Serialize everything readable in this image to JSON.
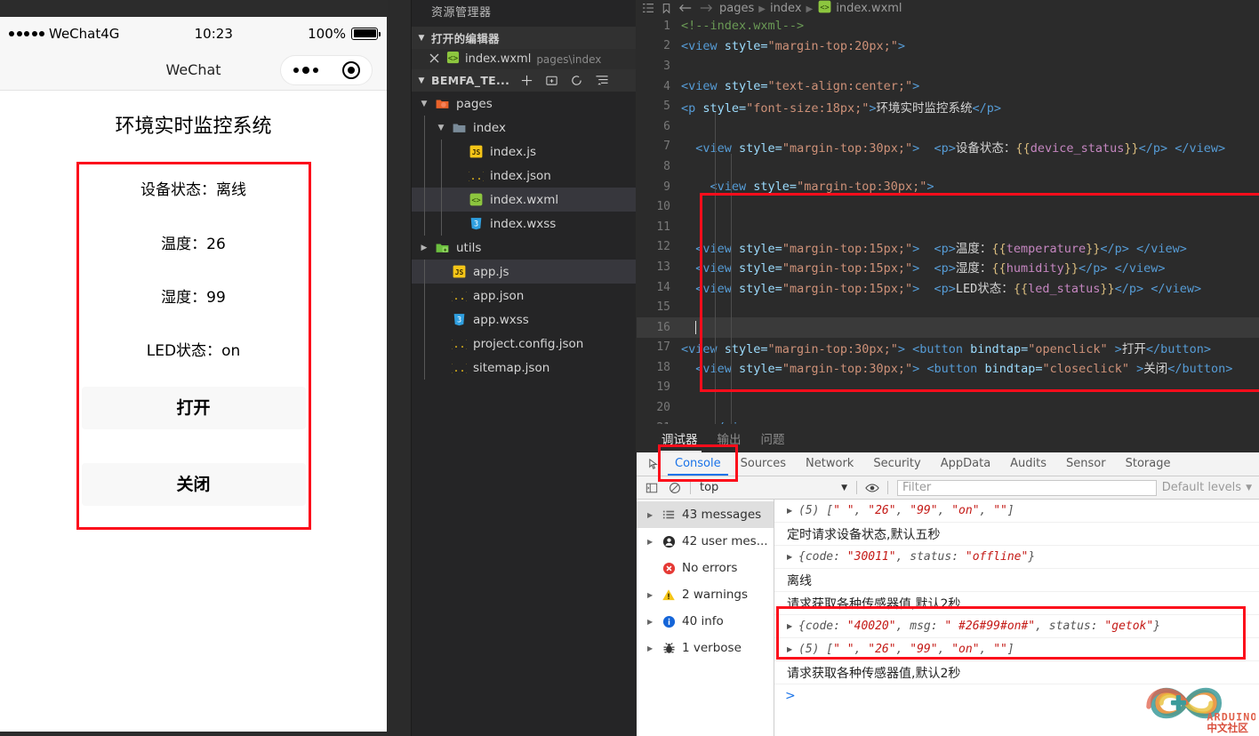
{
  "simulator": {
    "status_bar": {
      "carrier": "WeChat4G",
      "time": "10:23",
      "battery": "100%"
    },
    "nav": {
      "title": "WeChat"
    },
    "app": {
      "title": "环境实时监控系统",
      "device_status_label": "设备状态：",
      "device_status_value": "离线",
      "temperature_label": "温度：",
      "temperature_value": "26",
      "humidity_label": "湿度：",
      "humidity_value": "99",
      "led_label": "LED状态：",
      "led_value": "on",
      "open_button": "打开",
      "close_button": "关闭"
    }
  },
  "explorer": {
    "title": "资源管理器",
    "open_editors": {
      "label": "打开的编辑器",
      "file": "index.wxml",
      "path": "pages\\index"
    },
    "project": {
      "label": "BEMFA_TE..."
    },
    "tree": [
      {
        "name": "pages",
        "icon": "folder-open-orange",
        "depth": 1,
        "twisty": "▼",
        "selected": false
      },
      {
        "name": "index",
        "icon": "folder-open-gray",
        "depth": 2,
        "twisty": "▼",
        "selected": false
      },
      {
        "name": "index.js",
        "icon": "js",
        "depth": 3,
        "twisty": "",
        "selected": false
      },
      {
        "name": "index.json",
        "icon": "json",
        "depth": 3,
        "twisty": "",
        "selected": false
      },
      {
        "name": "index.wxml",
        "icon": "wxml",
        "depth": 3,
        "twisty": "",
        "selected": true
      },
      {
        "name": "index.wxss",
        "icon": "css",
        "depth": 3,
        "twisty": "",
        "selected": false
      },
      {
        "name": "utils",
        "icon": "folder-green",
        "depth": 1,
        "twisty": "▶",
        "selected": false
      },
      {
        "name": "app.js",
        "icon": "js",
        "depth": 2,
        "twisty": "",
        "selected": true
      },
      {
        "name": "app.json",
        "icon": "json",
        "depth": 2,
        "twisty": "",
        "selected": false
      },
      {
        "name": "app.wxss",
        "icon": "css",
        "depth": 2,
        "twisty": "",
        "selected": false
      },
      {
        "name": "project.config.json",
        "icon": "json",
        "depth": 2,
        "twisty": "",
        "selected": false
      },
      {
        "name": "sitemap.json",
        "icon": "json",
        "depth": 2,
        "twisty": "",
        "selected": false
      }
    ]
  },
  "editor": {
    "breadcrumb": [
      "pages",
      "index",
      "index.wxml"
    ],
    "lines": [
      {
        "n": 1,
        "tokens": [
          {
            "t": "cmt",
            "v": "<!--index.wxml-->"
          }
        ],
        "indent": 0
      },
      {
        "n": 2,
        "tokens": [
          {
            "t": "tag",
            "v": "<view"
          },
          {
            "t": "attr",
            "v": " style="
          },
          {
            "t": "str",
            "v": "\"margin-top:20px;\""
          },
          {
            "t": "tag",
            "v": ">"
          }
        ],
        "indent": 0
      },
      {
        "n": 3,
        "tokens": [],
        "indent": 0
      },
      {
        "n": 4,
        "tokens": [
          {
            "t": "tag",
            "v": "<view"
          },
          {
            "t": "attr",
            "v": " style="
          },
          {
            "t": "str",
            "v": "\"text-align:center;\""
          },
          {
            "t": "tag",
            "v": ">"
          }
        ],
        "indent": 0
      },
      {
        "n": 5,
        "tokens": [
          {
            "t": "tag",
            "v": "<p"
          },
          {
            "t": "attr",
            "v": " style="
          },
          {
            "t": "str",
            "v": "\"font-size:18px;\""
          },
          {
            "t": "tag",
            "v": ">"
          },
          {
            "t": "txt",
            "v": "环境实时监控系统"
          },
          {
            "t": "tag",
            "v": "</p>"
          }
        ],
        "indent": 0
      },
      {
        "n": 6,
        "tokens": [],
        "indent": 0
      },
      {
        "n": 7,
        "tokens": [
          {
            "t": "tag",
            "v": "<view"
          },
          {
            "t": "attr",
            "v": " style="
          },
          {
            "t": "str",
            "v": "\"margin-top:30px;\""
          },
          {
            "t": "tag",
            "v": ">"
          },
          {
            "t": "txt",
            "v": "  "
          },
          {
            "t": "tag",
            "v": "<p>"
          },
          {
            "t": "txt",
            "v": "设备状态："
          },
          {
            "t": "brk",
            "v": "{{"
          },
          {
            "t": "pnk",
            "v": "device_status"
          },
          {
            "t": "brk",
            "v": "}}"
          },
          {
            "t": "tag",
            "v": "</p>"
          },
          {
            "t": "txt",
            "v": " "
          },
          {
            "t": "tag",
            "v": "</view>"
          }
        ],
        "indent": 1
      },
      {
        "n": 8,
        "tokens": [],
        "indent": 1
      },
      {
        "n": 9,
        "tokens": [
          {
            "t": "tag",
            "v": "<view"
          },
          {
            "t": "attr",
            "v": " style="
          },
          {
            "t": "str",
            "v": "\"margin-top:30px;\""
          },
          {
            "t": "tag",
            "v": ">"
          }
        ],
        "indent": 2
      },
      {
        "n": 10,
        "tokens": [],
        "indent": 1
      },
      {
        "n": 11,
        "tokens": [],
        "indent": 1
      },
      {
        "n": 12,
        "tokens": [
          {
            "t": "tag",
            "v": "<view"
          },
          {
            "t": "attr",
            "v": " style="
          },
          {
            "t": "str",
            "v": "\"margin-top:15px;\""
          },
          {
            "t": "tag",
            "v": ">"
          },
          {
            "t": "txt",
            "v": "  "
          },
          {
            "t": "tag",
            "v": "<p>"
          },
          {
            "t": "txt",
            "v": "温度："
          },
          {
            "t": "brk",
            "v": "{{"
          },
          {
            "t": "pnk",
            "v": "temperature"
          },
          {
            "t": "brk",
            "v": "}}"
          },
          {
            "t": "tag",
            "v": "</p>"
          },
          {
            "t": "txt",
            "v": " "
          },
          {
            "t": "tag",
            "v": "</view>"
          }
        ],
        "indent": 1
      },
      {
        "n": 13,
        "tokens": [
          {
            "t": "tag",
            "v": "<view"
          },
          {
            "t": "attr",
            "v": " style="
          },
          {
            "t": "str",
            "v": "\"margin-top:15px;\""
          },
          {
            "t": "tag",
            "v": ">"
          },
          {
            "t": "txt",
            "v": "  "
          },
          {
            "t": "tag",
            "v": "<p>"
          },
          {
            "t": "txt",
            "v": "湿度："
          },
          {
            "t": "brk",
            "v": "{{"
          },
          {
            "t": "pnk",
            "v": "humidity"
          },
          {
            "t": "brk",
            "v": "}}"
          },
          {
            "t": "tag",
            "v": "</p>"
          },
          {
            "t": "txt",
            "v": " "
          },
          {
            "t": "tag",
            "v": "</view>"
          }
        ],
        "indent": 1
      },
      {
        "n": 14,
        "tokens": [
          {
            "t": "tag",
            "v": "<view"
          },
          {
            "t": "attr",
            "v": " style="
          },
          {
            "t": "str",
            "v": "\"margin-top:15px;\""
          },
          {
            "t": "tag",
            "v": ">"
          },
          {
            "t": "txt",
            "v": "  "
          },
          {
            "t": "tag",
            "v": "<p>"
          },
          {
            "t": "txt",
            "v": "LED状态："
          },
          {
            "t": "brk",
            "v": "{{"
          },
          {
            "t": "pnk",
            "v": "led_status"
          },
          {
            "t": "brk",
            "v": "}}"
          },
          {
            "t": "tag",
            "v": "</p>"
          },
          {
            "t": "txt",
            "v": " "
          },
          {
            "t": "tag",
            "v": "</view>"
          }
        ],
        "indent": 1
      },
      {
        "n": 15,
        "tokens": [],
        "indent": 1
      },
      {
        "n": 16,
        "tokens": [],
        "indent": 1,
        "highlight": true,
        "cursor": true
      },
      {
        "n": 17,
        "tokens": [
          {
            "t": "tag",
            "v": "<view"
          },
          {
            "t": "attr",
            "v": " style="
          },
          {
            "t": "str",
            "v": "\"margin-top:30px;\""
          },
          {
            "t": "tag",
            "v": ">"
          },
          {
            "t": "txt",
            "v": " "
          },
          {
            "t": "tag",
            "v": "<button"
          },
          {
            "t": "attr",
            "v": " bindtap="
          },
          {
            "t": "str",
            "v": "\"openclick\""
          },
          {
            "t": "tag",
            "v": " >"
          },
          {
            "t": "txt",
            "v": "打开"
          },
          {
            "t": "tag",
            "v": "</button>"
          }
        ],
        "indent": 0
      },
      {
        "n": 18,
        "tokens": [
          {
            "t": "tag",
            "v": "<view"
          },
          {
            "t": "attr",
            "v": " style="
          },
          {
            "t": "str",
            "v": "\"margin-top:30px;\""
          },
          {
            "t": "tag",
            "v": ">"
          },
          {
            "t": "txt",
            "v": " "
          },
          {
            "t": "tag",
            "v": "<button"
          },
          {
            "t": "attr",
            "v": " bindtap="
          },
          {
            "t": "str",
            "v": "\"closeclick\""
          },
          {
            "t": "tag",
            "v": " >"
          },
          {
            "t": "txt",
            "v": "关闭"
          },
          {
            "t": "tag",
            "v": "</button>"
          }
        ],
        "indent": 1
      },
      {
        "n": 19,
        "tokens": [],
        "indent": 1
      },
      {
        "n": 20,
        "tokens": [],
        "indent": 1
      },
      {
        "n": 21,
        "tokens": [
          {
            "t": "tag",
            "v": "</view>"
          }
        ],
        "indent": 2
      }
    ]
  },
  "devtools": {
    "top_tabs": [
      {
        "label": "调试器",
        "active": true
      },
      {
        "label": "输出",
        "active": false
      },
      {
        "label": "问题",
        "active": false
      }
    ],
    "panel_tabs": [
      {
        "label": "Console",
        "active": true
      },
      {
        "label": "Sources",
        "active": false
      },
      {
        "label": "Network",
        "active": false
      },
      {
        "label": "Security",
        "active": false
      },
      {
        "label": "AppData",
        "active": false
      },
      {
        "label": "Audits",
        "active": false
      },
      {
        "label": "Sensor",
        "active": false
      },
      {
        "label": "Storage",
        "active": false
      }
    ],
    "filter_bar": {
      "context": "top",
      "filter_placeholder": "Filter",
      "filter_value": "",
      "levels": "Default levels"
    },
    "counts": [
      {
        "label": "43 messages",
        "icon": "list-icon",
        "twisty": "▶",
        "selected": true
      },
      {
        "label": "42 user mes...",
        "icon": "user-icon",
        "twisty": "▶",
        "selected": false
      },
      {
        "label": "No errors",
        "icon": "error-icon",
        "twisty": "",
        "selected": false
      },
      {
        "label": "2 warnings",
        "icon": "warning-icon",
        "twisty": "▶",
        "selected": false
      },
      {
        "label": "40 info",
        "icon": "info-icon",
        "twisty": "▶",
        "selected": false
      },
      {
        "label": "1 verbose",
        "icon": "bug-icon",
        "twisty": "▶",
        "selected": false
      }
    ],
    "log": [
      {
        "kind": "array",
        "expand": true,
        "prefix": "(5) ",
        "items": [
          "\" \"",
          "\"26\"",
          "\"99\"",
          "\"on\"",
          "\"\""
        ]
      },
      {
        "kind": "text",
        "expand": false,
        "text": "定时请求设备状态,默认五秒"
      },
      {
        "kind": "object",
        "expand": true,
        "pairs": [
          {
            "k": "code: ",
            "v": "\"30011\""
          },
          {
            "k": "status: ",
            "v": "\"offline\""
          }
        ]
      },
      {
        "kind": "text",
        "expand": false,
        "text": "离线"
      },
      {
        "kind": "text",
        "expand": false,
        "text": "请求获取各种传感器值,默认2秒"
      },
      {
        "kind": "object",
        "expand": true,
        "pairs": [
          {
            "k": "code: ",
            "v": "\"40020\""
          },
          {
            "k": "msg: ",
            "v": "\" #26#99#on#\""
          },
          {
            "k": "status: ",
            "v": "\"getok\""
          }
        ]
      },
      {
        "kind": "array",
        "expand": true,
        "prefix": "(5) ",
        "items": [
          "\" \"",
          "\"26\"",
          "\"99\"",
          "\"on\"",
          "\"\""
        ]
      },
      {
        "kind": "text",
        "expand": false,
        "text": "请求获取各种传感器值,默认2秒"
      }
    ],
    "prompt": ">"
  },
  "watermark": {
    "brand": "ARDUINO",
    "sub": "中文社区"
  },
  "colors": {
    "annotation_red": "#fc0d1b",
    "editor_bg": "#2b2b2b",
    "explorer_bg": "#252526",
    "accent_blue": "#1a73e8"
  }
}
